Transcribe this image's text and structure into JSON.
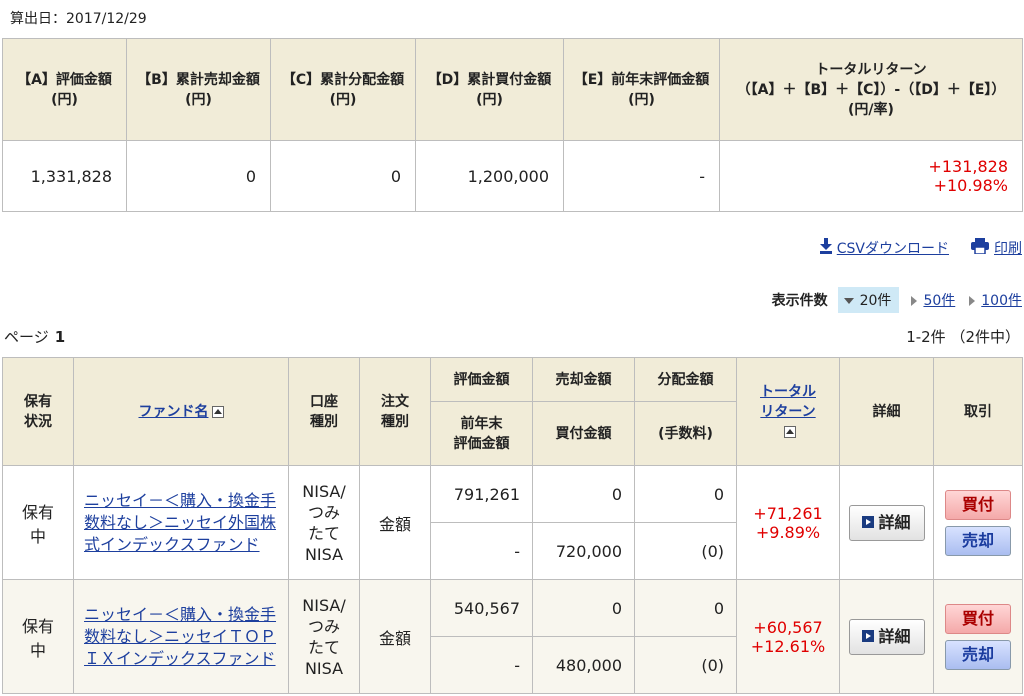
{
  "calc_date": "算出日：2017/12/29",
  "summary": {
    "headers": [
      "【A】評価金額\n(円)",
      "【B】累計売却金額\n(円)",
      "【C】累計分配金額\n(円)",
      "【D】累計買付金額\n(円)",
      "【E】前年末評価金額\n(円)",
      "トータルリターン\n（【A】＋【B】＋【C】）-（【D】＋【E】）\n(円/率)"
    ],
    "values": [
      "1,331,828",
      "0",
      "0",
      "1,200,000",
      "-"
    ],
    "total_return_amount": "+131,828",
    "total_return_rate": "+10.98%"
  },
  "actions": {
    "csv_label": "CSVダウンロード",
    "print_label": "印刷"
  },
  "display_count": {
    "label": "表示件数",
    "selected": "20件",
    "options": [
      "50件",
      "100件"
    ]
  },
  "pagination": {
    "page_label": "ページ",
    "page_number": "1",
    "range_text": "1-2件 （2件中）"
  },
  "fund_table": {
    "headers": {
      "status": "保有\n状況",
      "fund_name": "ファンド名",
      "account_type": "口座\n種別",
      "order_type": "注文\n種別",
      "valuation": "評価金額",
      "prev_year_valuation": "前年末\n評価金額",
      "sell_amount": "売却金額",
      "buy_amount": "買付金額",
      "dist_amount": "分配金額",
      "fee": "(手数料)",
      "total_return": "トータル\nリターン",
      "detail": "詳細",
      "trade": "取引"
    },
    "rows": [
      {
        "status": "保有\n中",
        "fund_name": "ニッセイ－＜購入・換金手数料なし＞ニッセイ外国株式インデックスファンド",
        "account_type": "NISA/\nつみ\nたて\nNISA",
        "order_type": "金額",
        "valuation": "791,261",
        "sell_amount": "0",
        "dist_amount": "0",
        "prev_year_valuation": "-",
        "buy_amount": "720,000",
        "fee": "(0)",
        "return_amount": "+71,261",
        "return_rate": "+9.89%",
        "detail_label": "詳細",
        "buy_label": "買付",
        "sell_label": "売却"
      },
      {
        "status": "保有\n中",
        "fund_name": "ニッセイ－＜購入・換金手数料なし＞ニッセイＴＯＰＩＸインデックスファンド",
        "account_type": "NISA/\nつみ\nたて\nNISA",
        "order_type": "金額",
        "valuation": "540,567",
        "sell_amount": "0",
        "dist_amount": "0",
        "prev_year_valuation": "-",
        "buy_amount": "480,000",
        "fee": "(0)",
        "return_amount": "+60,567",
        "return_rate": "+12.61%",
        "detail_label": "詳細",
        "buy_label": "買付",
        "sell_label": "売却"
      }
    ]
  },
  "colors": {
    "header_bg": "#f1ecd8",
    "link": "#1d3f9e",
    "positive": "#e00000",
    "selected_bg": "#cfe9f6"
  },
  "icons": [
    "download-icon",
    "printer-icon",
    "sort-up-icon",
    "play-icon"
  ]
}
